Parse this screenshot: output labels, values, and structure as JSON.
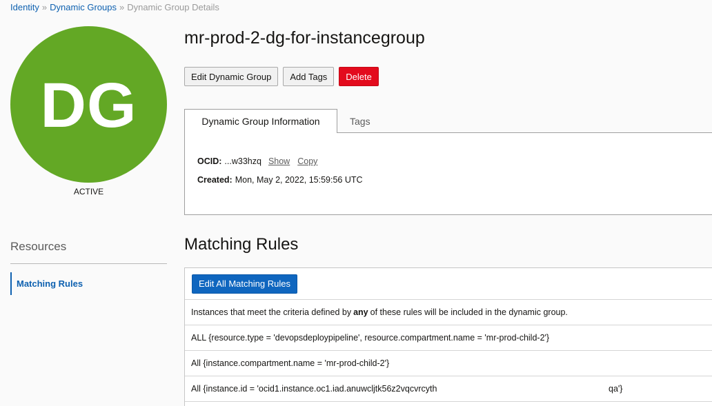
{
  "breadcrumb": {
    "items": [
      {
        "label": "Identity"
      },
      {
        "label": "Dynamic Groups"
      }
    ],
    "current": "Dynamic Group Details",
    "separator": "»"
  },
  "avatar": {
    "initials": "DG",
    "status": "ACTIVE",
    "color": "#63a825"
  },
  "resources": {
    "title": "Resources",
    "items": [
      {
        "label": "Matching Rules"
      }
    ]
  },
  "page": {
    "title": "mr-prod-2-dg-for-instancegroup"
  },
  "actions": {
    "edit": "Edit Dynamic Group",
    "tags": "Add Tags",
    "delete": "Delete"
  },
  "tabs": [
    {
      "label": "Dynamic Group Information",
      "active": true
    },
    {
      "label": "Tags",
      "active": false
    }
  ],
  "info": {
    "ocid_label": "OCID:",
    "ocid_value": "...w33hzq",
    "show_link": "Show",
    "copy_link": "Copy",
    "created_label": "Created:",
    "created_value": "Mon, May 2, 2022, 15:59:56 UTC"
  },
  "matching_rules": {
    "title": "Matching Rules",
    "edit_button": "Edit All Matching Rules",
    "description_pre": "Instances that meet the criteria defined by",
    "description_bold": "any",
    "description_post": "of these rules will be included in the dynamic group.",
    "rules": [
      {
        "text": "ALL {resource.type = 'devopsdeploypipeline', resource.compartment.name = 'mr-prod-child-2'}"
      },
      {
        "text": "All {instance.compartment.name = 'mr-prod-child-2'}"
      },
      {
        "text": "All {instance.id = 'ocid1.instance.oc1.iad.anuwcljtk56z2vqcvrcyth",
        "text_end": "qa'}"
      }
    ]
  },
  "colors": {
    "link": "#0e61b0",
    "danger": "#e30b1d",
    "primary": "#0f66bf"
  }
}
